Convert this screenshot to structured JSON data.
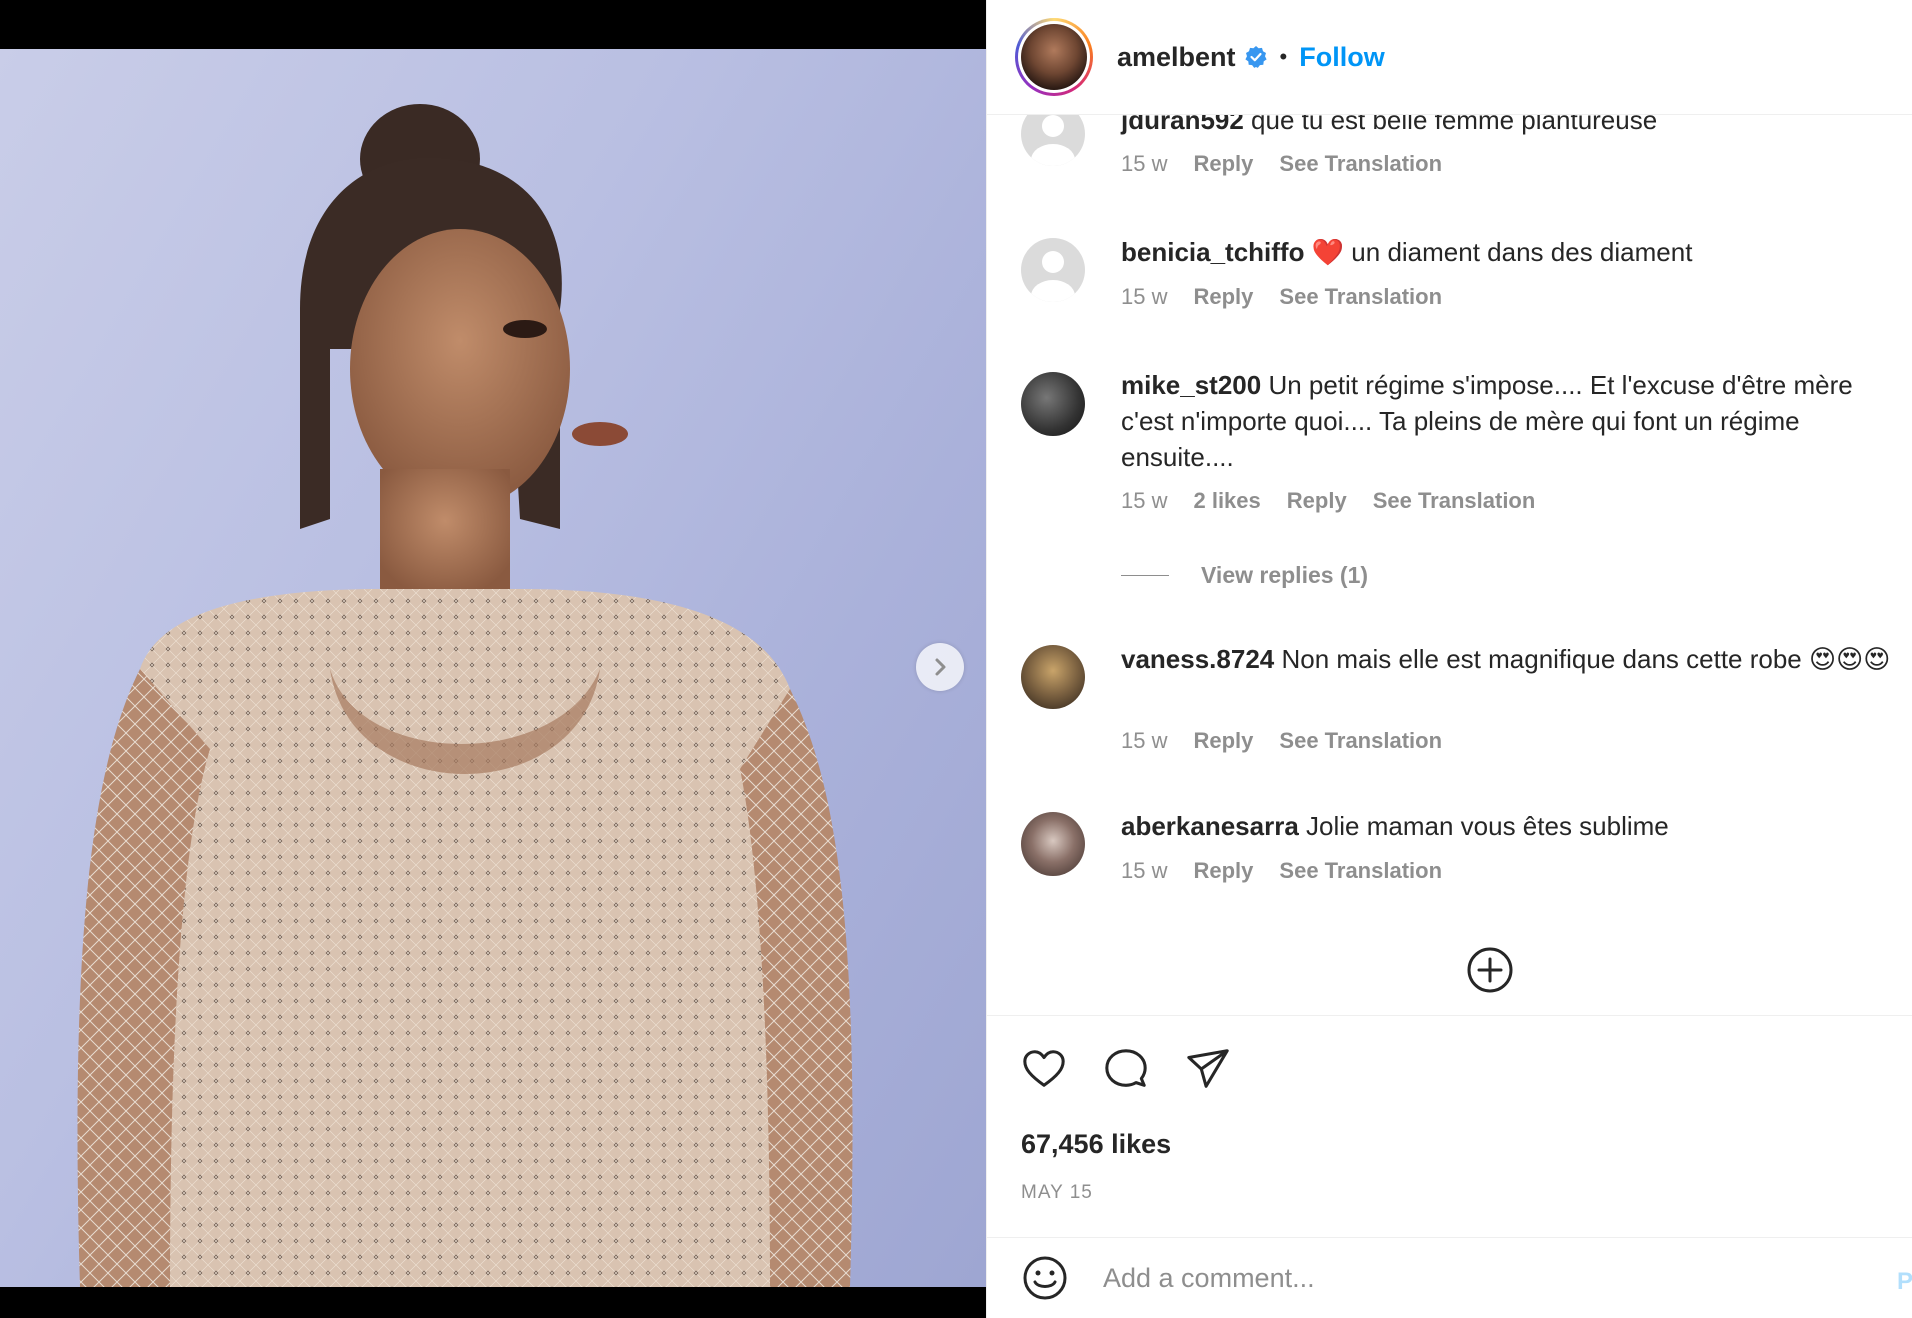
{
  "post": {
    "username": "amelbent",
    "follow_label": "Follow",
    "separator": "•",
    "likes": "67,456 likes",
    "date": "MAY 15"
  },
  "comments": [
    {
      "user": "jduran592",
      "text": " que tu est belle femme plantureuse",
      "time": "15 w",
      "likes": "",
      "reply": "Reply",
      "translate": "See Translation"
    },
    {
      "user": "benicia_tchiffo",
      "text": " ❤️ un diament dans des diament",
      "time": "15 w",
      "likes": "",
      "reply": "Reply",
      "translate": "See Translation"
    },
    {
      "user": "mike_st200",
      "text": " Un petit régime s'impose.... Et l'excuse d'être mère c'est n'importe quoi.... Ta pleins de mère qui font un régime ensuite....",
      "time": "15 w",
      "likes": "2 likes",
      "reply": "Reply",
      "translate": "See Translation"
    },
    {
      "user": "vaness.8724",
      "text": " Non mais elle est magnifique dans cette robe 😍😍😍",
      "time": "15 w",
      "likes": "",
      "reply": "Reply",
      "translate": "See Translation"
    },
    {
      "user": "aberkanesarra",
      "text": " Jolie maman vous êtes sublime",
      "time": "15 w",
      "likes": "",
      "reply": "Reply",
      "translate": "See Translation"
    }
  ],
  "view_replies": "View replies (1)",
  "add_comment": {
    "placeholder": "Add a comment...",
    "post_label": "P"
  },
  "icons": {
    "like": "heart-icon",
    "comment": "comment-icon",
    "share": "share-icon",
    "emoji": "emoji-icon",
    "load_more": "plus-circle-icon",
    "next": "chevron-right-icon",
    "verified": "verified-badge-icon"
  },
  "colors": {
    "accent": "#0095f6",
    "muted": "#8e8e8e",
    "text": "#262626"
  }
}
